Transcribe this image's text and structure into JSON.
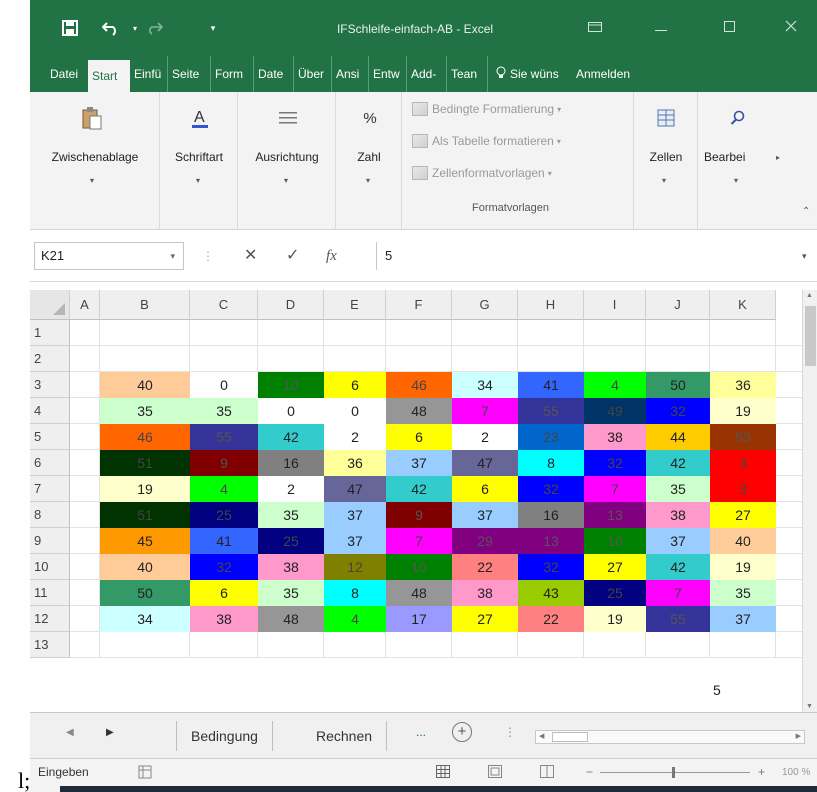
{
  "app": {
    "title": "IFSchleife-einfach-AB - Excel",
    "accent": "#217346"
  },
  "qat": {
    "save_icon": "save-icon",
    "undo_icon": "undo-icon",
    "redo_icon": "redo-icon",
    "customize_icon": "customize-qat-icon"
  },
  "ribbon_tabs": [
    {
      "label": "Datei"
    },
    {
      "label": "Start"
    },
    {
      "label": "Einfü"
    },
    {
      "label": "Seite"
    },
    {
      "label": "Form"
    },
    {
      "label": "Date"
    },
    {
      "label": "Über"
    },
    {
      "label": "Ansi"
    },
    {
      "label": "Entw"
    },
    {
      "label": "Add-"
    },
    {
      "label": "Tean"
    },
    {
      "label": "Sie wüns"
    },
    {
      "label": "Anmelden"
    }
  ],
  "ribbon": {
    "clipboard": "Zwischenablage",
    "font": "Schriftart",
    "alignment": "Ausrichtung",
    "number": "Zahl",
    "styles": {
      "conditional": "Bedingte Formatierung",
      "as_table": "Als Tabelle formatieren",
      "cell_styles": "Zellenformatvorlagen",
      "group_label": "Formatvorlagen"
    },
    "cells": "Zellen",
    "editing": "Bearbei"
  },
  "formula_bar": {
    "name_box": "K21",
    "fx": "fx",
    "value": "5"
  },
  "grid": {
    "columns": [
      "A",
      "B",
      "C",
      "D",
      "E",
      "F",
      "G",
      "H",
      "I",
      "J",
      "K"
    ],
    "rows": [
      "1",
      "2",
      "3",
      "4",
      "5",
      "6",
      "7",
      "8",
      "9",
      "10",
      "11",
      "12",
      "13"
    ],
    "data": [
      [
        [
          "40",
          "#ffcc99",
          "#222"
        ],
        [
          "0",
          "#ffffff",
          "#222"
        ],
        [
          "10",
          "#008000",
          "#555"
        ],
        [
          "6",
          "#ffff00",
          "#222"
        ],
        [
          "46",
          "#ff6600",
          "#444"
        ],
        [
          "34",
          "#ccffff",
          "#222"
        ],
        [
          "41",
          "#3366ff",
          "#222"
        ],
        [
          "4",
          "#00ff00",
          "#444"
        ],
        [
          "50",
          "#339966",
          "#222"
        ],
        [
          "36",
          "#ffff99",
          "#222"
        ]
      ],
      [
        [
          "35",
          "#ccffcc",
          "#222"
        ],
        [
          "35",
          "#ccffcc",
          "#222"
        ],
        [
          "0",
          "#ffffff",
          "#222"
        ],
        [
          "0",
          "#ffffff",
          "#222"
        ],
        [
          "48",
          "#969696",
          "#222"
        ],
        [
          "7",
          "#ff00ff",
          "#444"
        ],
        [
          "55",
          "#333399",
          "#555"
        ],
        [
          "49",
          "#003366",
          "#444"
        ],
        [
          "32",
          "#0000ff",
          "#444"
        ],
        [
          "19",
          "#ffffcc",
          "#222"
        ]
      ],
      [
        [
          "46",
          "#ff6600",
          "#444"
        ],
        [
          "55",
          "#333399",
          "#555"
        ],
        [
          "42",
          "#33cccc",
          "#222"
        ],
        [
          "2",
          "#ffffff",
          "#222"
        ],
        [
          "6",
          "#ffff00",
          "#222"
        ],
        [
          "2",
          "#ffffff",
          "#222"
        ],
        [
          "23",
          "#0066cc",
          "#444"
        ],
        [
          "38",
          "#ff99cc",
          "#222"
        ],
        [
          "44",
          "#ffcc00",
          "#222"
        ],
        [
          "53",
          "#993300",
          "#555"
        ]
      ],
      [
        [
          "51",
          "#003300",
          "#444"
        ],
        [
          "9",
          "#800000",
          "#555"
        ],
        [
          "16",
          "#808080",
          "#222"
        ],
        [
          "36",
          "#ffff99",
          "#222"
        ],
        [
          "37",
          "#99ccff",
          "#222"
        ],
        [
          "47",
          "#666699",
          "#222"
        ],
        [
          "8",
          "#00ffff",
          "#222"
        ],
        [
          "32",
          "#0000ff",
          "#444"
        ],
        [
          "42",
          "#33cccc",
          "#222"
        ],
        [
          "3",
          "#ff0000",
          "#444"
        ]
      ],
      [
        [
          "19",
          "#ffffcc",
          "#222"
        ],
        [
          "4",
          "#00ff00",
          "#444"
        ],
        [
          "2",
          "#ffffff",
          "#222"
        ],
        [
          "47",
          "#666699",
          "#222"
        ],
        [
          "42",
          "#33cccc",
          "#222"
        ],
        [
          "6",
          "#ffff00",
          "#222"
        ],
        [
          "32",
          "#0000ff",
          "#444"
        ],
        [
          "7",
          "#ff00ff",
          "#444"
        ],
        [
          "35",
          "#ccffcc",
          "#222"
        ],
        [
          "3",
          "#ff0000",
          "#444"
        ]
      ],
      [
        [
          "51",
          "#003300",
          "#444"
        ],
        [
          "25",
          "#000080",
          "#444"
        ],
        [
          "35",
          "#ccffcc",
          "#222"
        ],
        [
          "37",
          "#99ccff",
          "#222"
        ],
        [
          "9",
          "#800000",
          "#555"
        ],
        [
          "37",
          "#99ccff",
          "#222"
        ],
        [
          "16",
          "#808080",
          "#222"
        ],
        [
          "13",
          "#800080",
          "#555"
        ],
        [
          "38",
          "#ff99cc",
          "#222"
        ],
        [
          "27",
          "#ffff00",
          "#222"
        ]
      ],
      [
        [
          "45",
          "#ff9900",
          "#222"
        ],
        [
          "41",
          "#3366ff",
          "#222"
        ],
        [
          "25",
          "#000080",
          "#444"
        ],
        [
          "37",
          "#99ccff",
          "#222"
        ],
        [
          "7",
          "#ff00ff",
          "#444"
        ],
        [
          "29",
          "#800080",
          "#555"
        ],
        [
          "13",
          "#800080",
          "#555"
        ],
        [
          "10",
          "#008000",
          "#555"
        ],
        [
          "37",
          "#99ccff",
          "#222"
        ],
        [
          "40",
          "#ffcc99",
          "#222"
        ]
      ],
      [
        [
          "40",
          "#ffcc99",
          "#222"
        ],
        [
          "32",
          "#0000ff",
          "#444"
        ],
        [
          "38",
          "#ff99cc",
          "#222"
        ],
        [
          "12",
          "#808000",
          "#444"
        ],
        [
          "10",
          "#008000",
          "#555"
        ],
        [
          "22",
          "#ff8080",
          "#222"
        ],
        [
          "32",
          "#0000ff",
          "#444"
        ],
        [
          "27",
          "#ffff00",
          "#222"
        ],
        [
          "42",
          "#33cccc",
          "#222"
        ],
        [
          "19",
          "#ffffcc",
          "#222"
        ]
      ],
      [
        [
          "50",
          "#339966",
          "#222"
        ],
        [
          "6",
          "#ffff00",
          "#222"
        ],
        [
          "35",
          "#ccffcc",
          "#222"
        ],
        [
          "8",
          "#00ffff",
          "#222"
        ],
        [
          "48",
          "#969696",
          "#222"
        ],
        [
          "38",
          "#ff99cc",
          "#222"
        ],
        [
          "43",
          "#99cc00",
          "#222"
        ],
        [
          "25",
          "#000080",
          "#444"
        ],
        [
          "7",
          "#ff00ff",
          "#444"
        ],
        [
          "35",
          "#ccffcc",
          "#222"
        ]
      ],
      [
        [
          "34",
          "#ccffff",
          "#222"
        ],
        [
          "38",
          "#ff99cc",
          "#222"
        ],
        [
          "48",
          "#969696",
          "#222"
        ],
        [
          "4",
          "#00ff00",
          "#444"
        ],
        [
          "17",
          "#9999ff",
          "#222"
        ],
        [
          "27",
          "#ffff00",
          "#222"
        ],
        [
          "22",
          "#ff8080",
          "#222"
        ],
        [
          "19",
          "#ffffcc",
          "#222"
        ],
        [
          "55",
          "#333399",
          "#555"
        ],
        [
          "37",
          "#99ccff",
          "#222"
        ]
      ]
    ],
    "row13_k": "5"
  },
  "sheet_tabs": [
    {
      "label": "Bedingung"
    },
    {
      "label": "Rechnen"
    }
  ],
  "sheet_more": "...",
  "sheet_add": "+",
  "status": {
    "mode": "Eingeben",
    "zoom": "100 %"
  },
  "outer": {
    "letter": "l;"
  }
}
